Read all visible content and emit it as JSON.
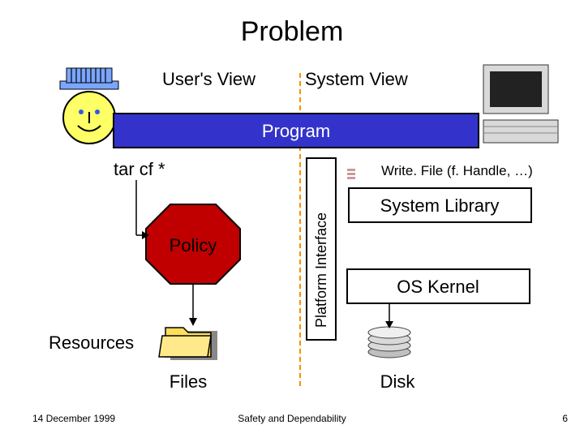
{
  "title": "Problem",
  "heads": {
    "user": "User's View",
    "system": "System View"
  },
  "programBar": "Program",
  "left": {
    "cmd": "tar cf *",
    "policy": "Policy",
    "resources": "Resources",
    "files": "Files"
  },
  "center": "Platform Interface",
  "right": {
    "call": "Write. File (f. Handle, …)",
    "lib": "System Library",
    "kernel": "OS Kernel",
    "disk": "Disk"
  },
  "footer": {
    "date": "14 December 1999",
    "title": "Safety and Dependability",
    "page": "6"
  }
}
